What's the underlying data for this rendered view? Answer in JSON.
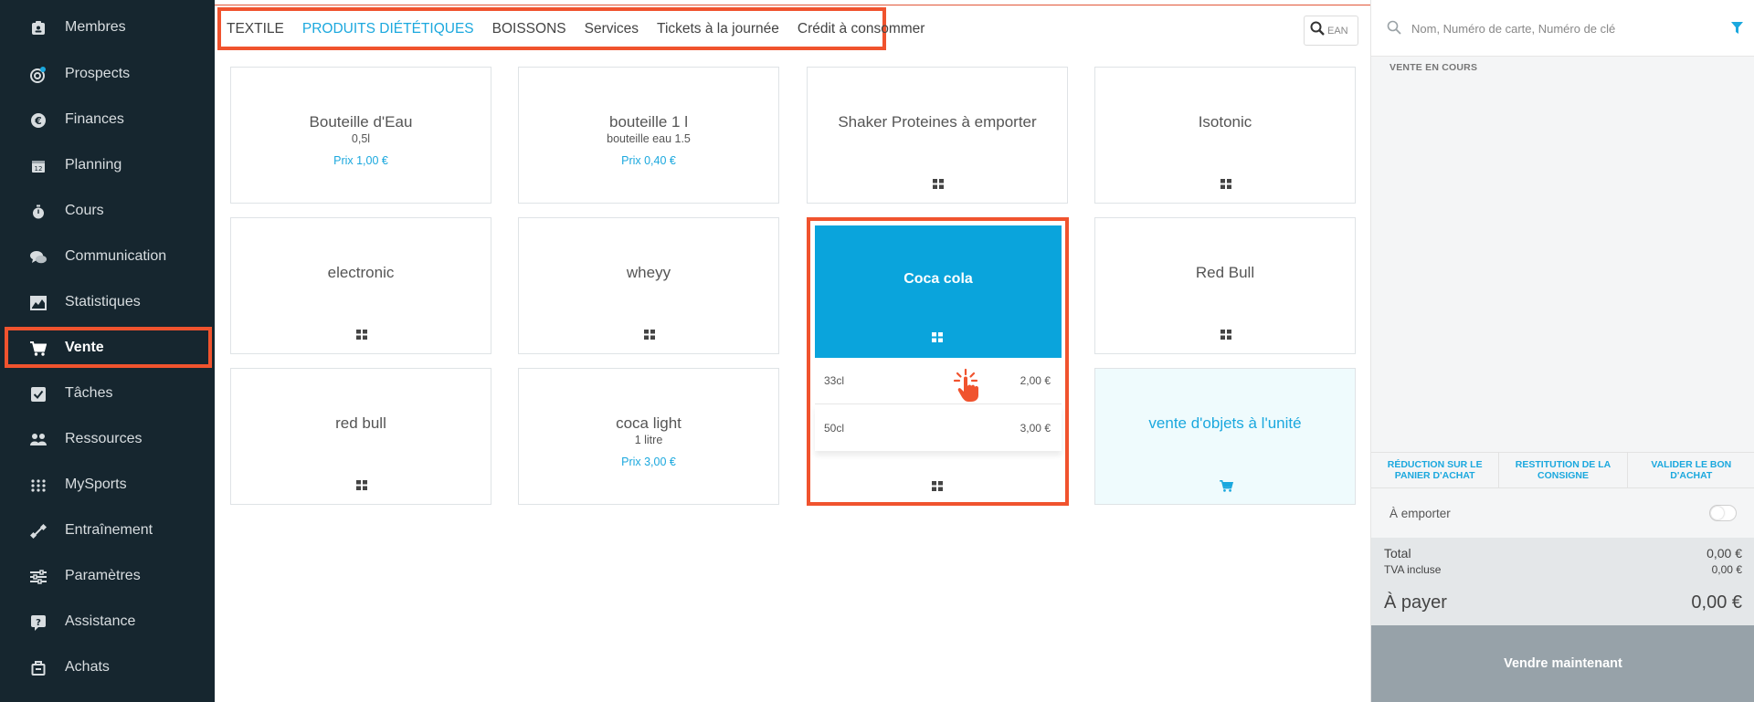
{
  "sidebar": {
    "items": [
      {
        "label": "Membres",
        "icon": "id-card-icon"
      },
      {
        "label": "Prospects",
        "icon": "target-icon"
      },
      {
        "label": "Finances",
        "icon": "euro-icon"
      },
      {
        "label": "Planning",
        "icon": "calendar-icon"
      },
      {
        "label": "Cours",
        "icon": "stopwatch-icon"
      },
      {
        "label": "Communication",
        "icon": "chat-icon"
      },
      {
        "label": "Statistiques",
        "icon": "chart-icon"
      },
      {
        "label": "Vente",
        "icon": "cart-icon",
        "active": true
      },
      {
        "label": "Tâches",
        "icon": "checkbox-icon"
      },
      {
        "label": "Ressources",
        "icon": "users-icon"
      },
      {
        "label": "MySports",
        "icon": "dots-icon"
      },
      {
        "label": "Entraînement",
        "icon": "dumbbell-icon"
      },
      {
        "label": "Paramètres",
        "icon": "sliders-icon"
      },
      {
        "label": "Assistance",
        "icon": "help-icon"
      },
      {
        "label": "Achats",
        "icon": "box-icon"
      }
    ]
  },
  "tabs": {
    "items": [
      "TEXTILE",
      "PRODUITS DIÉTÉTIQUES",
      "BOISSONS",
      "Services",
      "Tickets à la journée",
      "Crédit à consommer"
    ],
    "active_index": 1
  },
  "ean_search": {
    "placeholder": "EAN"
  },
  "products": [
    {
      "title": "Bouteille d'Eau",
      "subtitle": "0,5l",
      "price": "Prix 1,00 €"
    },
    {
      "title": "bouteille 1 l",
      "subtitle": "bouteille eau 1.5",
      "price": "Prix 0,40 €"
    },
    {
      "title": "Shaker Proteines à emporter"
    },
    {
      "title": "Isotonic"
    },
    {
      "title": "electronic"
    },
    {
      "title": "wheyy"
    },
    {
      "title": "Red Bull"
    },
    {
      "title": "red bull"
    },
    {
      "title": "coca light",
      "subtitle": "1 litre",
      "price": "Prix 3,00 €"
    }
  ],
  "expanded_product": {
    "title": "Coca cola",
    "variants": [
      {
        "size": "33cl",
        "price": "2,00 €"
      },
      {
        "size": "50cl",
        "price": "3,00 €"
      }
    ]
  },
  "unit_sale": {
    "title": "vente d'objets à l'unité"
  },
  "panel": {
    "search_placeholder": "Nom, Numéro de carte, Numéro de clé",
    "section_title": "VENTE EN COURS",
    "actions": [
      "RÉDUCTION SUR LE PANIER D'ACHAT",
      "RESTITUTION DE LA CONSIGNE",
      "VALIDER LE BON D'ACHAT"
    ],
    "takeaway_label": "À emporter",
    "total_label": "Total",
    "total_value": "0,00 €",
    "vat_label": "TVA incluse",
    "vat_value": "0,00 €",
    "to_pay_label": "À payer",
    "to_pay_value": "0,00 €",
    "sell_button": "Vendre maintenant"
  },
  "colors": {
    "accent": "#1ba8de",
    "highlight": "#f0532e",
    "sidebar_bg": "#16262f",
    "selected_card": "#0aa4dc"
  }
}
